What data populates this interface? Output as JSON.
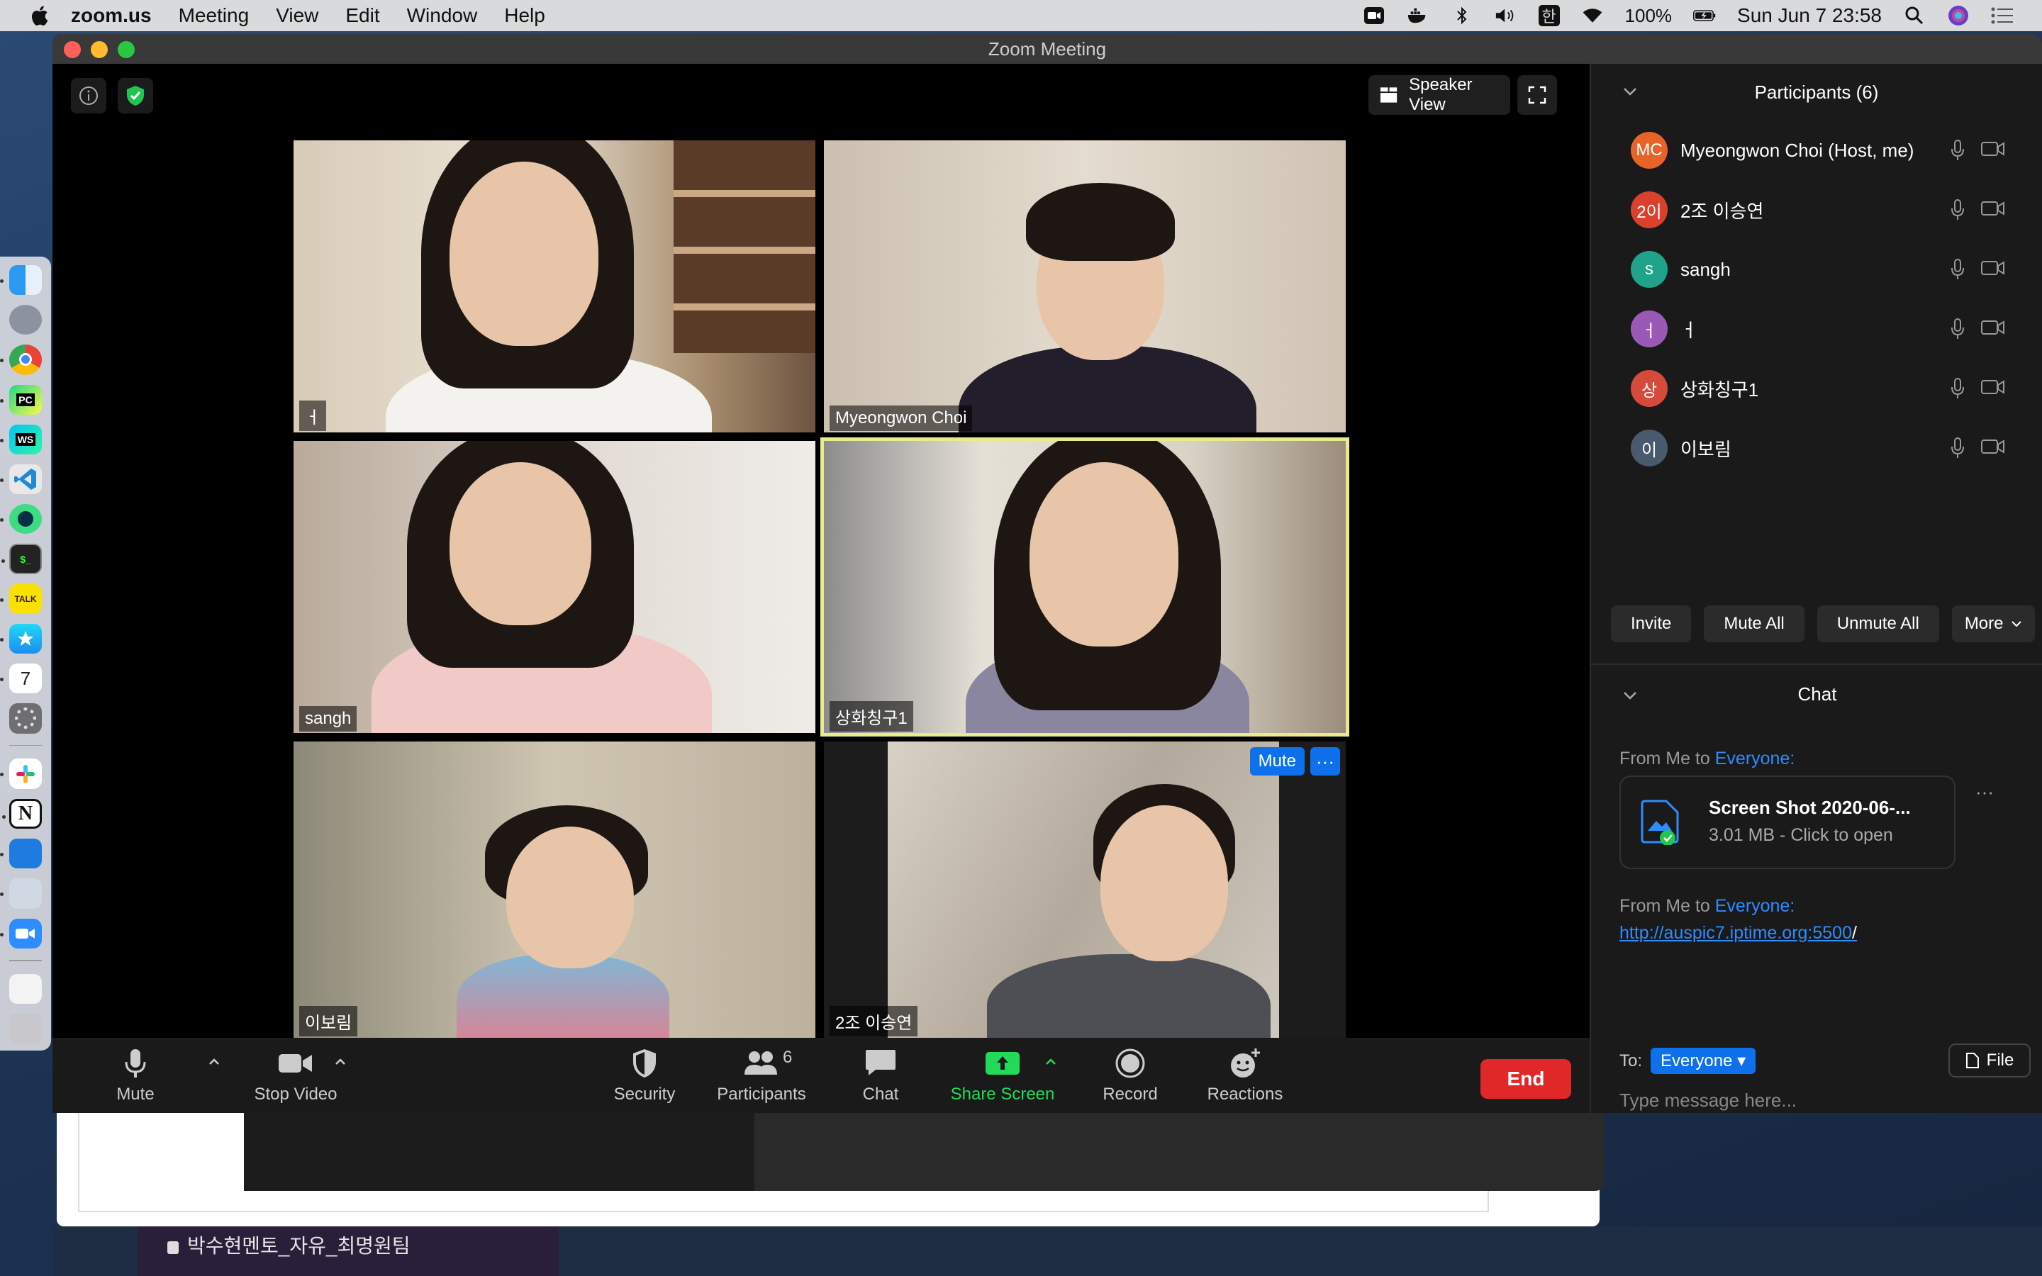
{
  "menubar": {
    "app_name": "zoom.us",
    "menus": [
      "Meeting",
      "View",
      "Edit",
      "Window",
      "Help"
    ],
    "battery": "100%",
    "clock": "Sun Jun 7  23:58",
    "input_source": "한"
  },
  "window": {
    "title": "Zoom Meeting"
  },
  "meeting": {
    "speaker_view_label": "Speaker View",
    "tiles": [
      {
        "name": "ㅓ"
      },
      {
        "name": "Myeongwon Choi"
      },
      {
        "name": "sangh"
      },
      {
        "name": "상화칭구1",
        "active": true
      },
      {
        "name": "이보림"
      },
      {
        "name": "2조 이승연"
      }
    ],
    "tile_mute_label": "Mute",
    "tile_more_label": "···"
  },
  "toolbar": {
    "mute_label": "Mute",
    "stop_video_label": "Stop Video",
    "security_label": "Security",
    "participants_label": "Participants",
    "participants_count": "6",
    "chat_label": "Chat",
    "share_screen_label": "Share Screen",
    "record_label": "Record",
    "reactions_label": "Reactions",
    "end_label": "End"
  },
  "participants_panel": {
    "title": "Participants (6)",
    "participants": [
      {
        "initials": "MC",
        "name": "Myeongwon Choi (Host, me)",
        "color": "#e8632a"
      },
      {
        "initials": "2이",
        "name": "2조 이승연",
        "color": "#d9412d"
      },
      {
        "initials": "s",
        "name": "sangh",
        "color": "#1fa38a"
      },
      {
        "initials": "ㅓ",
        "name": "ㅓ",
        "color": "#9b59b6"
      },
      {
        "initials": "상",
        "name": "상화칭구1",
        "color": "#d64a3a"
      },
      {
        "initials": "이",
        "name": "이보림",
        "color": "#4a5a6e"
      }
    ],
    "invite_label": "Invite",
    "mute_all_label": "Mute All",
    "unmute_all_label": "Unmute All",
    "more_label": "More"
  },
  "chat": {
    "title": "Chat",
    "messages": [
      {
        "from_prefix": "From Me to ",
        "to": "Everyone:",
        "file_name": "Screen Shot 2020-06-...",
        "file_meta": "3.01 MB - Click to open"
      },
      {
        "from_prefix": "From Me to ",
        "to": "Everyone:",
        "link": "http://auspic7.iptime.org:5500",
        "link_suffix": "/"
      }
    ],
    "to_label": "To:",
    "to_value": "Everyone",
    "file_button_label": "File",
    "more_button_label": "···",
    "input_placeholder": "Type message here..."
  },
  "background": {
    "sidebar_text": "박수현멘토_자유_최명원팀"
  }
}
